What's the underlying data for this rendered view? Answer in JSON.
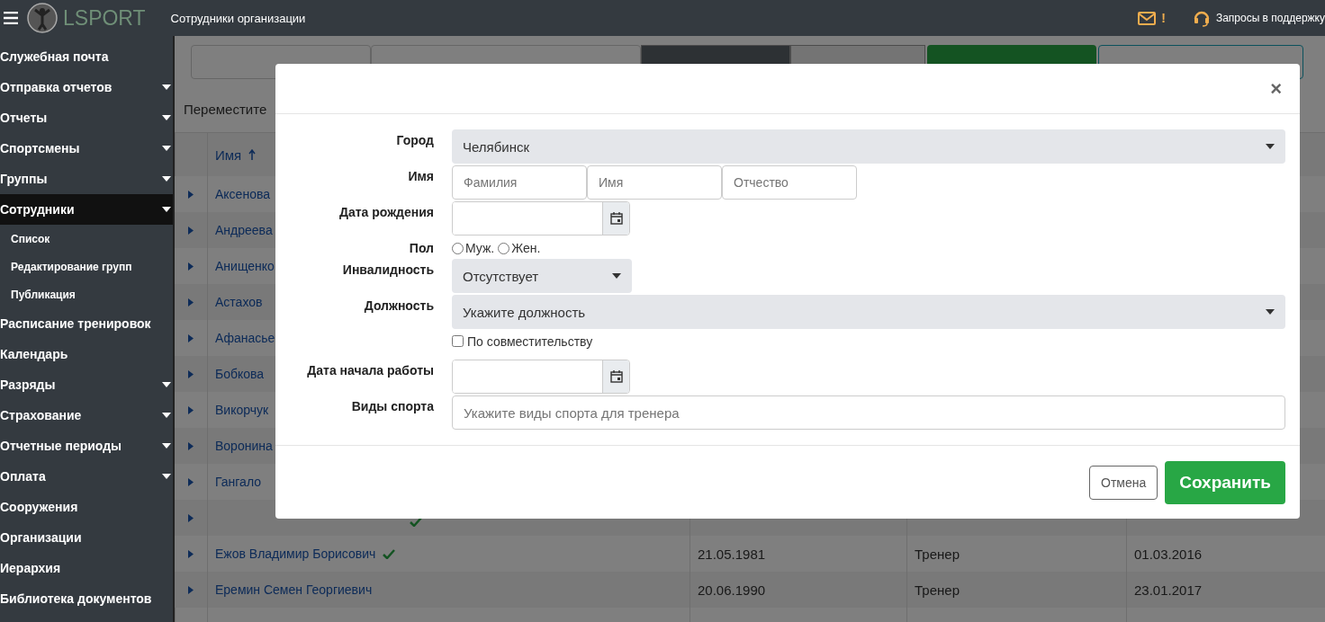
{
  "topbar": {
    "brand": "LSPORT",
    "title": "Сотрудники организации",
    "alert": "!",
    "support": "Запросы в поддержку"
  },
  "sidebar": {
    "items": [
      {
        "label": "Служебная почта",
        "expandable": false,
        "selected": false
      },
      {
        "label": "Отправка отчетов",
        "expandable": true,
        "selected": false
      },
      {
        "label": "Отчеты",
        "expandable": true,
        "selected": false
      },
      {
        "label": "Спортсмены",
        "expandable": true,
        "selected": false
      },
      {
        "label": "Группы",
        "expandable": true,
        "selected": false
      },
      {
        "label": "Сотрудники",
        "expandable": true,
        "selected": true,
        "children": [
          {
            "label": "Список"
          },
          {
            "label": "Редактирование групп"
          },
          {
            "label": "Публикация"
          }
        ]
      },
      {
        "label": "Расписание тренировок",
        "expandable": false,
        "selected": false
      },
      {
        "label": "Календарь",
        "expandable": false,
        "selected": false
      },
      {
        "label": "Разряды",
        "expandable": true,
        "selected": false
      },
      {
        "label": "Страхование",
        "expandable": true,
        "selected": false
      },
      {
        "label": "Отчетные периоды",
        "expandable": true,
        "selected": false
      },
      {
        "label": "Оплата",
        "expandable": true,
        "selected": false
      },
      {
        "label": "Сооружения",
        "expandable": false,
        "selected": false
      },
      {
        "label": "Организации",
        "expandable": false,
        "selected": false
      },
      {
        "label": "Иерархия",
        "expandable": false,
        "selected": false
      },
      {
        "label": "Библиотека документов",
        "expandable": false,
        "selected": false
      }
    ]
  },
  "toolbar": {
    "tabs": [
      {
        "selected": true
      },
      {
        "selected": false
      }
    ]
  },
  "group_hint": "Переместите",
  "table": {
    "columns": [
      "Имя"
    ],
    "rows": [
      {
        "name": "Аксенова",
        "verified": false
      },
      {
        "name": "Андреева",
        "verified": false
      },
      {
        "name": "Анищенко",
        "verified": false
      },
      {
        "name": "Астахов",
        "verified": false
      },
      {
        "name": "Афанасье",
        "verified": false
      },
      {
        "name": "Бобкова",
        "verified": false
      },
      {
        "name": "Викорчук",
        "verified": false
      },
      {
        "name": "Воронина",
        "verified": false
      },
      {
        "name": "Гангало",
        "verified": false
      },
      {
        "verified": true
      },
      {
        "name": "Ежов Владимир Борисович",
        "verified": true,
        "birth": "21.05.1981",
        "position": "Тренер",
        "start": "01.03.2016"
      },
      {
        "name": "Еремин Семен Георгиевич",
        "verified": false,
        "birth": "20.06.1990",
        "position": "Тренер",
        "start": "23.01.2017"
      }
    ]
  },
  "modal": {
    "close": "×",
    "city": {
      "label": "Город",
      "value": "Челябинск"
    },
    "name": {
      "label": "Имя",
      "fields": [
        {
          "placeholder": "Фамилия"
        },
        {
          "placeholder": "Имя"
        },
        {
          "placeholder": "Отчество"
        }
      ]
    },
    "birth": {
      "label": "Дата рождения"
    },
    "gender": {
      "label": "Пол",
      "options": [
        {
          "label": "Муж.",
          "selected": false
        },
        {
          "label": "Жен.",
          "selected": false
        }
      ]
    },
    "disability": {
      "label": "Инвалидность",
      "value": "Отсутствует"
    },
    "position": {
      "label": "Должность",
      "placeholder": "Укажите должность"
    },
    "part_time": {
      "label": "По совместительству",
      "checked": false
    },
    "start": {
      "label": "Дата начала работы"
    },
    "sports": {
      "label": "Виды спорта",
      "placeholder": "Укажите виды спорта для тренера"
    },
    "cancel": "Отмена",
    "save": "Сохранить"
  }
}
